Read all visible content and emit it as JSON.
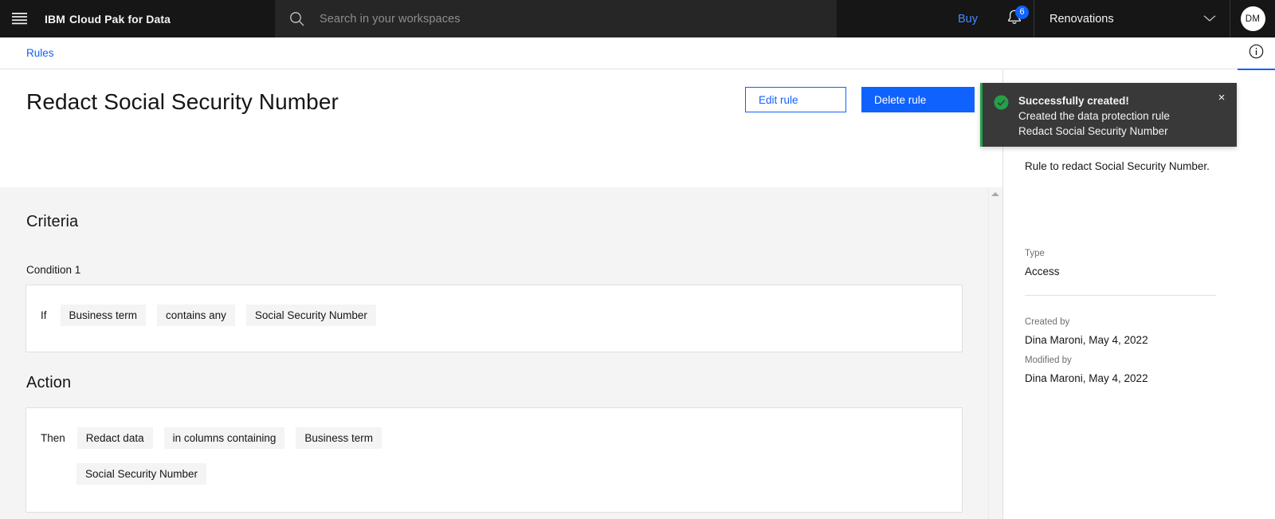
{
  "header": {
    "menu_icon": "hamburger-menu-icon",
    "brand_prefix": "IBM",
    "brand_name": "Cloud Pak for Data",
    "search": {
      "icon": "search-icon",
      "placeholder": "Search in your workspaces",
      "value": ""
    },
    "buy_label": "Buy",
    "notifications": {
      "icon": "bell-icon",
      "count": "6"
    },
    "workspace": {
      "label": "Renovations",
      "chevron_icon": "chevron-down-icon"
    },
    "avatar": {
      "initials": "DM",
      "name": "avatar"
    }
  },
  "subbar": {
    "breadcrumb": "Rules",
    "info_icon": "information-icon"
  },
  "title_band": {
    "title": "Redact Social Security Number",
    "edit_label": "Edit rule",
    "delete_label": "Delete rule"
  },
  "content": {
    "criteria_heading": "Criteria",
    "condition_label": "Condition 1",
    "criteria_row": {
      "keyword": "If",
      "chips": [
        "Business term",
        "contains any",
        "Social Security Number"
      ]
    },
    "action_heading": "Action",
    "action_row": {
      "keyword": "Then",
      "chips": [
        "Redact data",
        "in columns containing",
        "Business term"
      ],
      "chips_second_row": [
        "Social Security Number"
      ]
    }
  },
  "right_panel": {
    "description": "Rule to redact Social Security Number.",
    "type_label": "Type",
    "type_value": "Access",
    "created_label": "Created by",
    "created_value": "Dina Maroni, May 4, 2022",
    "modified_label": "Modified by",
    "modified_value": "Dina Maroni, May 4, 2022"
  },
  "toast": {
    "status_icon": "checkmark-filled-icon",
    "title": "Successfully created!",
    "line1": "Created the data protection rule",
    "line2": "Redact Social Security Number",
    "close_icon": "close-icon",
    "close_glyph": "×",
    "accent_color": "#24a148"
  },
  "colors": {
    "header_bg": "#161616",
    "search_bg": "#262626",
    "brand_blue": "#0f62fe",
    "link_blue": "#4589ff",
    "content_bg": "#f4f4f4",
    "chip_bg": "#f4f4f4",
    "toast_bg": "#393939",
    "success_green": "#24a148"
  }
}
